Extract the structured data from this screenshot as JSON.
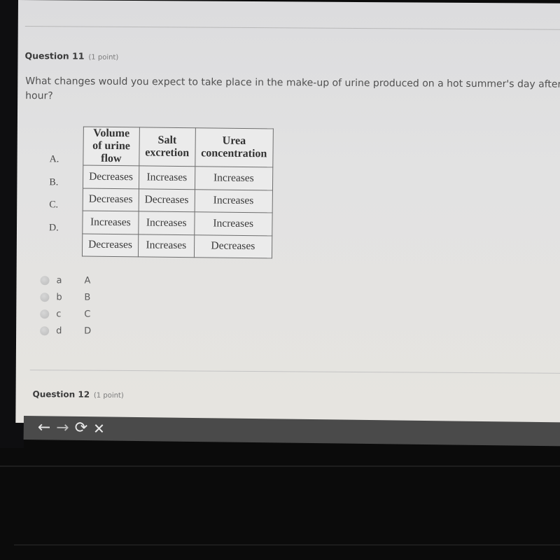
{
  "question11": {
    "number_label": "Question 11",
    "points_label": "(1 point)",
    "text": "What changes would you expect to take place in the make-up of urine produced on a hot summer's day after hour?",
    "table": {
      "headers": [
        "Volume of urine flow",
        "Salt excretion",
        "Urea concentration"
      ],
      "rows": [
        {
          "label": "A.",
          "cells": [
            "Decreases",
            "Increases",
            "Increases"
          ]
        },
        {
          "label": "B.",
          "cells": [
            "Decreases",
            "Decreases",
            "Increases"
          ]
        },
        {
          "label": "C.",
          "cells": [
            "Increases",
            "Increases",
            "Increases"
          ]
        },
        {
          "label": "D.",
          "cells": [
            "Decreases",
            "Increases",
            "Decreases"
          ]
        }
      ]
    },
    "options": [
      {
        "key": "a",
        "value": "A",
        "selected": false
      },
      {
        "key": "b",
        "value": "B",
        "selected": false
      },
      {
        "key": "c",
        "value": "C",
        "selected": false
      },
      {
        "key": "d",
        "value": "D",
        "selected": false
      }
    ]
  },
  "question12": {
    "number_label": "Question 12",
    "points_label": "(1 point)"
  },
  "toolbar": {
    "back_icon": "←",
    "forward_icon": "→",
    "reload_icon": "⟳",
    "close_icon": "✕"
  }
}
